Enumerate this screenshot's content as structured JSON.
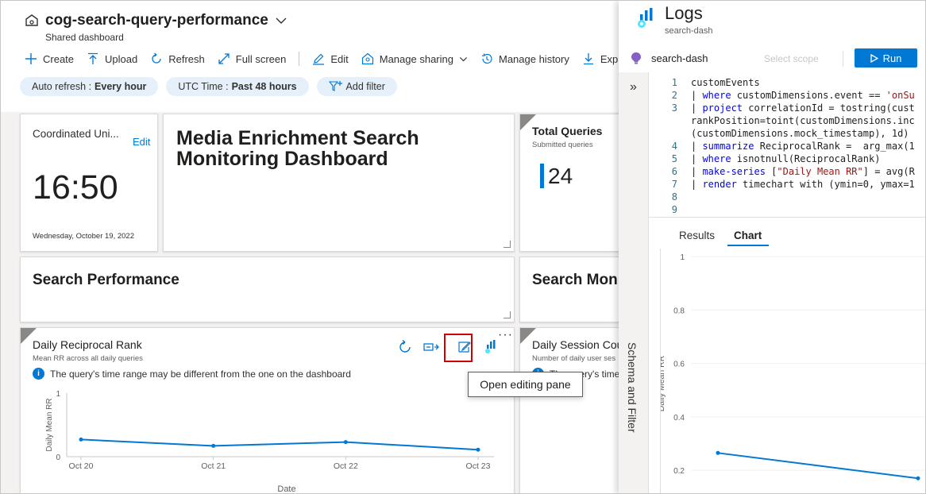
{
  "dashboard": {
    "title": "cog-search-query-performance",
    "subtitle": "Shared dashboard"
  },
  "toolbar": {
    "create": "Create",
    "upload": "Upload",
    "refresh": "Refresh",
    "full_screen": "Full screen",
    "edit": "Edit",
    "manage_sharing": "Manage sharing",
    "manage_history": "Manage history",
    "export": "Exp"
  },
  "pills": {
    "auto_refresh_label": "Auto refresh : ",
    "auto_refresh_value": "Every hour",
    "utc_label": "UTC Time : ",
    "utc_value": "Past 48 hours",
    "add_filter": "Add filter"
  },
  "clock_tile": {
    "title": "Coordinated Uni...",
    "edit": "Edit",
    "time": "16:50",
    "date": "Wednesday, October 19, 2022"
  },
  "markdown_tile": {
    "heading_line1": "Media Enrichment Search",
    "heading_line2": "Monitoring Dashboard"
  },
  "total_queries_tile": {
    "title": "Total Queries",
    "subtitle": "Submitted queries",
    "value": "24"
  },
  "section_tiles": {
    "search_performance": "Search Performance",
    "search_mon": "Search Mon"
  },
  "rr_tile": {
    "title": "Daily Reciprocal Rank",
    "subtitle": "Mean RR across all daily queries",
    "warning": "The query's time range may be different from the one on the dashboard",
    "tooltip": "Open editing pane",
    "ellipsis": "···"
  },
  "session_tile": {
    "title": "Daily Session Cou",
    "subtitle": "Number of daily user ses",
    "warning": "The query's time"
  },
  "rr_chart": {
    "chart_data": {
      "type": "line",
      "categories": [
        "Oct 20",
        "Oct 21",
        "Oct 22",
        "Oct 23"
      ],
      "y_ticks": [
        "1",
        "0"
      ],
      "ylabel": "Daily Mean RR",
      "xlabel": "Date",
      "ylim": [
        0,
        1
      ],
      "series": [
        {
          "values": [
            0.27,
            0.17,
            0.23,
            0.11
          ]
        }
      ],
      "color": "#0078d4"
    }
  },
  "logs": {
    "title": "Logs",
    "subtitle": "search-dash",
    "scope": "search-dash",
    "select_scope": "Select scope",
    "run": "Run",
    "rail_label": "Schema and Filter",
    "tab_results": "Results",
    "tab_chart": "Chart",
    "line_numbers": [
      "1",
      "2",
      "3",
      "",
      "",
      "4",
      "5",
      "6",
      "7",
      "8",
      "9"
    ]
  },
  "logs_chart": {
    "chart_data": {
      "type": "line",
      "y_ticks": [
        "1",
        "0.8",
        "0.6",
        "0.4",
        "0.2"
      ],
      "ylabel": "Daily Mean RR",
      "ylim": [
        0.15,
        1
      ],
      "series": [
        {
          "values": [
            0.265,
            0.17
          ]
        }
      ],
      "color": "#0078d4"
    }
  }
}
